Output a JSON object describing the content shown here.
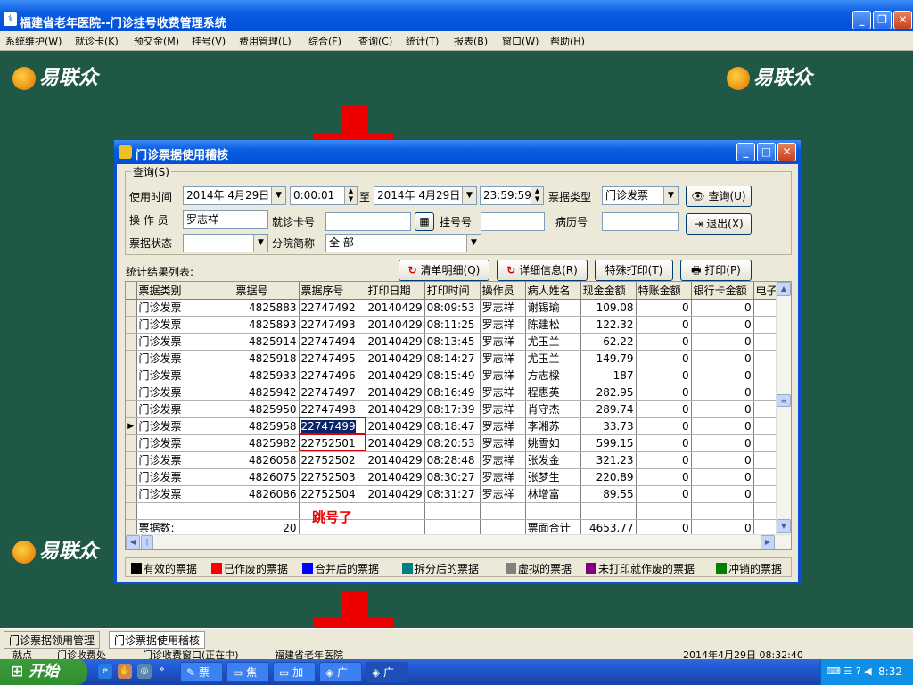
{
  "app": {
    "title": "福建省老年医院--门诊挂号收费管理系统"
  },
  "menu": [
    "系统维护(W)",
    "就诊卡(K)",
    "预交金(M)",
    "挂号(V)",
    "费用管理(L)",
    "综合(F)",
    "查询(C)",
    "统计(T)",
    "报表(B)",
    "窗口(W)",
    "帮助(H)"
  ],
  "desktop": {
    "logo_text": "易联众"
  },
  "dialog": {
    "title": "门诊票据使用稽核",
    "query": {
      "group_label": "查询(S)",
      "time_label": "使用时间",
      "date_from": "2014年 4月29日",
      "time_from": "0:00:01",
      "to_label": "至",
      "date_to": "2014年 4月29日",
      "time_to": "23:59:59",
      "type_label": "票据类型",
      "type_value": "门诊发票",
      "search_button": "查询(U)",
      "operator_label": "操 作 员",
      "operator_value": "罗志祥",
      "card_label": "就诊卡号",
      "card_value": "",
      "reg_label": "挂号号",
      "reg_value": "",
      "record_label": "病历号",
      "record_value": "",
      "exit_button": "退出(X)",
      "status_label": "票据状态",
      "status_value": "",
      "branch_label": "分院简称",
      "branch_value": "全 部"
    },
    "result_label": "统计结果列表:",
    "buttons": {
      "clear": "清单明细(Q)",
      "detail": "详细信息(R)",
      "special_print": "特殊打印(T)",
      "print": "打印(P)"
    },
    "table": {
      "columns": [
        "票据类别",
        "票据号",
        "票据序号",
        "打印日期",
        "打印时间",
        "操作员",
        "病人姓名",
        "现金金额",
        "特账金额",
        "银行卡金额",
        "电子"
      ],
      "rows": [
        [
          "门诊发票",
          "4825883",
          "22747492",
          "20140429",
          "08:09:53",
          "罗志祥",
          "谢锡瑜",
          "109.08",
          "0",
          "0"
        ],
        [
          "门诊发票",
          "4825893",
          "22747493",
          "20140429",
          "08:11:25",
          "罗志祥",
          "陈建松",
          "122.32",
          "0",
          "0"
        ],
        [
          "门诊发票",
          "4825914",
          "22747494",
          "20140429",
          "08:13:45",
          "罗志祥",
          "尤玉兰",
          "62.22",
          "0",
          "0"
        ],
        [
          "门诊发票",
          "4825918",
          "22747495",
          "20140429",
          "08:14:27",
          "罗志祥",
          "尤玉兰",
          "149.79",
          "0",
          "0"
        ],
        [
          "门诊发票",
          "4825933",
          "22747496",
          "20140429",
          "08:15:49",
          "罗志祥",
          "方志樑",
          "187",
          "0",
          "0"
        ],
        [
          "门诊发票",
          "4825942",
          "22747497",
          "20140429",
          "08:16:49",
          "罗志祥",
          "程惠英",
          "282.95",
          "0",
          "0"
        ],
        [
          "门诊发票",
          "4825950",
          "22747498",
          "20140429",
          "08:17:39",
          "罗志祥",
          "肖守杰",
          "289.74",
          "0",
          "0"
        ],
        [
          "门诊发票",
          "4825958",
          "22747499",
          "20140429",
          "08:18:47",
          "罗志祥",
          "李湘苏",
          "33.73",
          "0",
          "0"
        ],
        [
          "门诊发票",
          "4825982",
          "22752501",
          "20140429",
          "08:20:53",
          "罗志祥",
          "姚雪如",
          "599.15",
          "0",
          "0"
        ],
        [
          "门诊发票",
          "4826058",
          "22752502",
          "20140429",
          "08:28:48",
          "罗志祥",
          "张发金",
          "321.23",
          "0",
          "0"
        ],
        [
          "门诊发票",
          "4826075",
          "22752503",
          "20140429",
          "08:30:27",
          "罗志祥",
          "张梦生",
          "220.89",
          "0",
          "0"
        ],
        [
          "门诊发票",
          "4826086",
          "22752504",
          "20140429",
          "08:31:27",
          "罗志祥",
          "林增富",
          "89.55",
          "0",
          "0"
        ]
      ],
      "summary": {
        "label": "票据数:",
        "count": "20",
        "total_label": "票面合计",
        "cash_total": "4653.77",
        "special_total": "0",
        "bank_total": "0"
      },
      "selected_row": 7
    },
    "legend": [
      {
        "label": "有效的票据",
        "color": "#000000"
      },
      {
        "label": "已作废的票据",
        "color": "#ff0000"
      },
      {
        "label": "合并后的票据",
        "color": "#0000ff"
      },
      {
        "label": "拆分后的票据",
        "color": "#008080"
      },
      {
        "label": "虚拟的票据",
        "color": "#808080"
      },
      {
        "label": "未打印就作废的票据",
        "color": "#800080"
      },
      {
        "label": "冲销的票据",
        "color": "#008000"
      }
    ]
  },
  "annotation": "跳号了",
  "window_tabs": [
    "门诊票据领用管理",
    "门诊票据使用稽核"
  ],
  "status": {
    "left1": "就点",
    "left2": "门诊收费处",
    "left3": "门诊收费窗口(正在中)",
    "left4": "福建省老年医院",
    "right": "2014年4月29日 08:32:40"
  },
  "taskbar": {
    "start": "开始",
    "items": [
      "票",
      "焦",
      "加",
      "广",
      "广"
    ],
    "clock": "8:32"
  }
}
